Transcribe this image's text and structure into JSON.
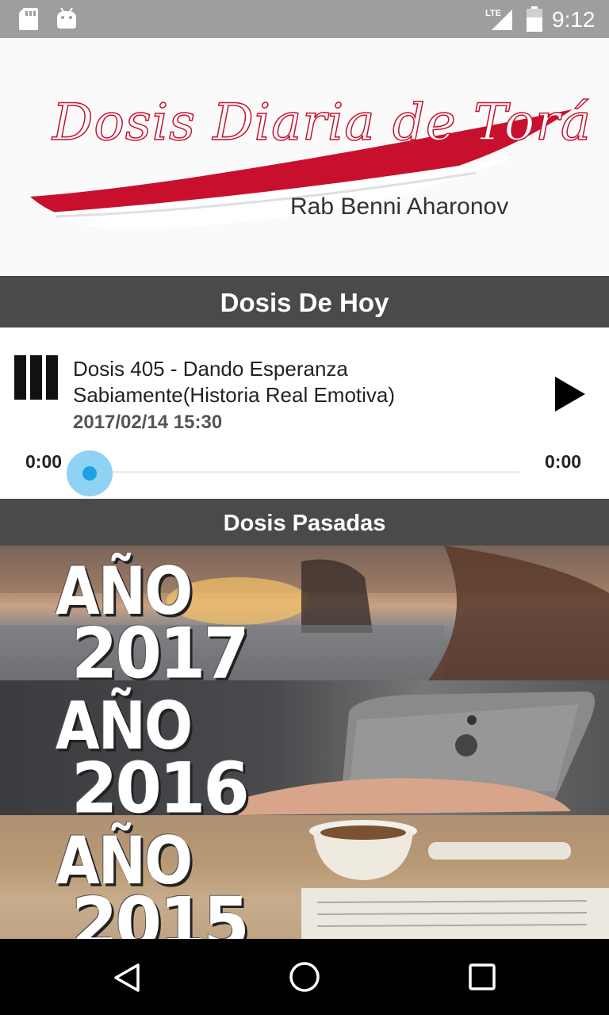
{
  "status_bar": {
    "time": "9:12",
    "network": "LTE",
    "icons": [
      "sd-card-icon",
      "android-icon",
      "lte-signal-icon",
      "battery-icon"
    ]
  },
  "logo": {
    "title": "Dosis Diaria de Torá",
    "subtitle": "Rab Benni Aharonov",
    "colors": {
      "red": "#c8102e"
    }
  },
  "today": {
    "header": "Dosis De Hoy",
    "track": {
      "title": "Dosis 405 - Dando Esperanza Sabiamente(Historia Real Emotiva)",
      "date": "2017/02/14 15:30",
      "time_elapsed": "0:00",
      "time_total": "0:00",
      "progress": 0
    }
  },
  "past": {
    "header": "Dosis Pasadas",
    "years": [
      {
        "word": "AÑO",
        "year": "2017"
      },
      {
        "word": "AÑO",
        "year": "2016"
      },
      {
        "word": "AÑO",
        "year": "2015"
      }
    ]
  },
  "nav_bar": {
    "buttons": [
      "back-icon",
      "home-icon",
      "recents-icon"
    ]
  },
  "colors": {
    "header_bg": "#4a4a4a",
    "seek_accent": "#1ea0e6",
    "status_bar_bg": "#9e9e9e"
  }
}
